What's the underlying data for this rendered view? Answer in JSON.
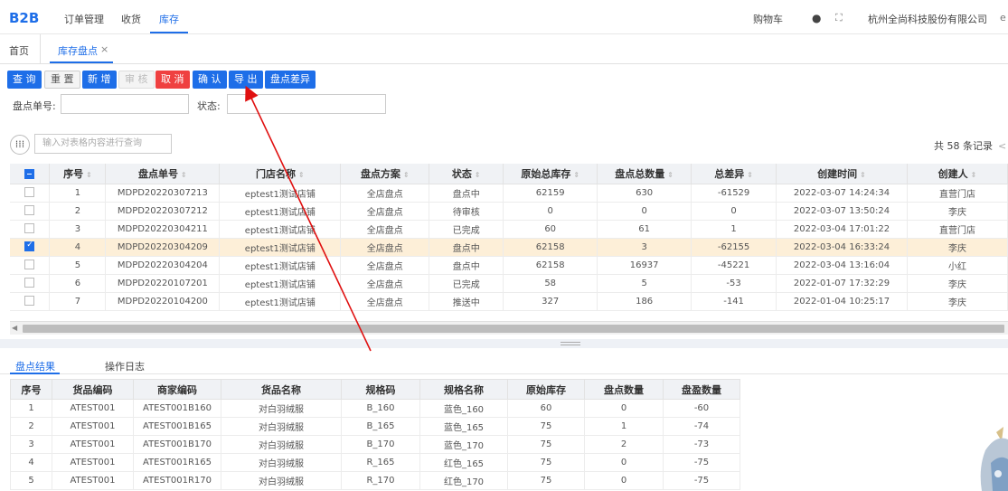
{
  "header": {
    "logo": "B2B",
    "nav": [
      "订单管理",
      "收货",
      "库存"
    ],
    "cart": "购物车",
    "company": "杭州全尚科技股份有限公司"
  },
  "tabs": {
    "home": "首页",
    "current": "库存盘点",
    "close": "×"
  },
  "toolbar": {
    "query": "查 询",
    "reset": "重 置",
    "add": "新 增",
    "review": "审 核",
    "cancel": "取 消",
    "confirm": "确 认",
    "export": "导 出",
    "diff": "盘点差异"
  },
  "filters": {
    "order_no_label": "盘点单号:",
    "status_label": "状态:"
  },
  "table_search": {
    "placeholder": "输入对表格内容进行查询"
  },
  "total": "共 58 条记录",
  "main_table": {
    "headers": [
      "序号",
      "盘点单号",
      "门店名称",
      "盘点方案",
      "状态",
      "原始总库存",
      "盘点总数量",
      "总差异",
      "创建时间",
      "创建人"
    ],
    "rows": [
      {
        "checked": false,
        "cells": [
          "1",
          "MDPD20220307213",
          "eptest1测试店铺",
          "全店盘点",
          "盘点中",
          "62159",
          "630",
          "-61529",
          "2022-03-07 14:24:34",
          "直营门店"
        ]
      },
      {
        "checked": false,
        "cells": [
          "2",
          "MDPD20220307212",
          "eptest1测试店铺",
          "全店盘点",
          "待审核",
          "0",
          "0",
          "0",
          "2022-03-07 13:50:24",
          "李庆"
        ]
      },
      {
        "checked": false,
        "cells": [
          "3",
          "MDPD20220304211",
          "eptest1测试店铺",
          "全店盘点",
          "已完成",
          "60",
          "61",
          "1",
          "2022-03-04 17:01:22",
          "直营门店"
        ]
      },
      {
        "checked": true,
        "cells": [
          "4",
          "MDPD20220304209",
          "eptest1测试店铺",
          "全店盘点",
          "盘点中",
          "62158",
          "3",
          "-62155",
          "2022-03-04 16:33:24",
          "李庆"
        ]
      },
      {
        "checked": false,
        "cells": [
          "5",
          "MDPD20220304204",
          "eptest1测试店铺",
          "全店盘点",
          "盘点中",
          "62158",
          "16937",
          "-45221",
          "2022-03-04 13:16:04",
          "小红"
        ]
      },
      {
        "checked": false,
        "cells": [
          "6",
          "MDPD20220107201",
          "eptest1测试店铺",
          "全店盘点",
          "已完成",
          "58",
          "5",
          "-53",
          "2022-01-07 17:32:29",
          "李庆"
        ]
      },
      {
        "checked": false,
        "cells": [
          "7",
          "MDPD20220104200",
          "eptest1测试店铺",
          "全店盘点",
          "推送中",
          "327",
          "186",
          "-141",
          "2022-01-04 10:25:17",
          "李庆"
        ]
      }
    ]
  },
  "bottom_tabs": [
    "盘点结果",
    "操作日志"
  ],
  "sub_table": {
    "headers": [
      "序号",
      "货品编码",
      "商家编码",
      "货品名称",
      "规格码",
      "规格名称",
      "原始库存",
      "盘点数量",
      "盘盈数量"
    ],
    "rows": [
      [
        "1",
        "ATEST001",
        "ATEST001B160",
        "对白羽绒服",
        "B_160",
        "蓝色_160",
        "60",
        "0",
        "-60"
      ],
      [
        "2",
        "ATEST001",
        "ATEST001B165",
        "对白羽绒服",
        "B_165",
        "蓝色_165",
        "75",
        "1",
        "-74"
      ],
      [
        "3",
        "ATEST001",
        "ATEST001B170",
        "对白羽绒服",
        "B_170",
        "蓝色_170",
        "75",
        "2",
        "-73"
      ],
      [
        "4",
        "ATEST001",
        "ATEST001R165",
        "对白羽绒服",
        "R_165",
        "红色_165",
        "75",
        "0",
        "-75"
      ],
      [
        "5",
        "ATEST001",
        "ATEST001R170",
        "对白羽绒服",
        "R_170",
        "红色_170",
        "75",
        "0",
        "-75"
      ]
    ]
  },
  "colors": {
    "accent": "#1e6ee8",
    "danger": "#ef4040",
    "selected_row": "#fdefd8",
    "annotation_arrow": "#e01010"
  }
}
